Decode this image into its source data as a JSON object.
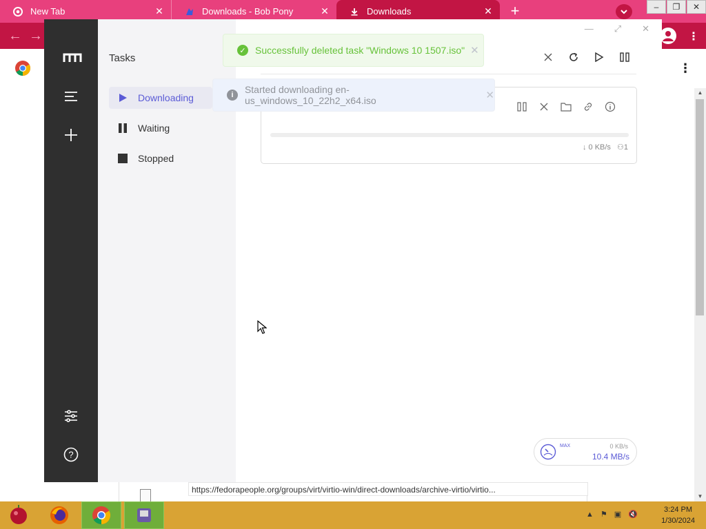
{
  "browser": {
    "tabs": [
      {
        "title": "New Tab",
        "icon": "chrome-icon"
      },
      {
        "title": "Downloads - Bob Pony",
        "icon": "bob-pony-icon"
      },
      {
        "title": "Downloads",
        "icon": "download-icon",
        "active": true
      }
    ],
    "accent": "#c21544",
    "tabstrip_color": "#e8407d"
  },
  "app": {
    "sidebar_title": "Tasks",
    "sidebar_items": [
      {
        "label": "Downloading",
        "icon": "play-icon"
      },
      {
        "label": "Waiting",
        "icon": "pause-icon"
      },
      {
        "label": "Stopped",
        "icon": "stop-icon"
      }
    ],
    "accent": "#5b5bd6",
    "task": {
      "speed": "↓ 0 KB/s",
      "connections": "1",
      "progress": 0
    },
    "speedometer": {
      "max_label": "MAX",
      "upload": "0 KB/s",
      "download": "10.4 MB/s"
    }
  },
  "toasts": {
    "success": "Successfully deleted task \"Windows 10 1507.iso\"",
    "info": "Started downloading en-us_windows_10_22h2_x64.iso"
  },
  "statusbar": {
    "url": "https://fedorapeople.org/groups/virt/virtio-win/direct-downloads/archive-virtio/virtio..."
  },
  "taskbar": {
    "time": "3:24 PM",
    "date": "1/30/2024",
    "color": "#d9a334"
  }
}
